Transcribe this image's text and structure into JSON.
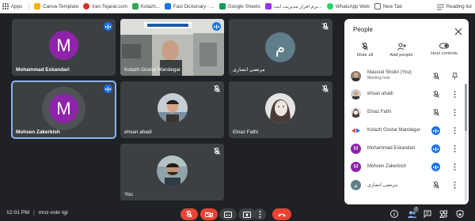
{
  "bookmarks": [
    {
      "label": "Apps",
      "icon": "apps-grid-icon",
      "color": "#5f6368"
    },
    {
      "label": "Canva-Template",
      "icon": "bookmark-icon",
      "color": "#f4b400"
    },
    {
      "label": "Iran-Tejarat.com",
      "icon": "site-icon",
      "color": "#d93025"
    },
    {
      "label": "Kolazh...",
      "icon": "site-icon",
      "color": "#34a853"
    },
    {
      "label": "Fast Dictionary - ...",
      "icon": "site-icon",
      "color": "#1a73e8"
    },
    {
      "label": "Google Sheets",
      "icon": "sheets-icon",
      "color": "#0f9d58"
    },
    {
      "label": "نرم افزار مدیریت ایت...",
      "icon": "site-icon",
      "color": "#9334e6"
    },
    {
      "label": "WhatsApp Web",
      "icon": "whatsapp-icon",
      "color": "#25d366"
    },
    {
      "label": "New Tab",
      "icon": "new-tab-icon",
      "color": "#5f6368"
    }
  ],
  "reading_list": "Reading list",
  "tiles": [
    {
      "name": "Mohammad Eskandari",
      "initial": "M",
      "type": "avatar",
      "mic": "active"
    },
    {
      "name": "Kolazh Gostar Mandegar",
      "type": "video",
      "mic": "active"
    },
    {
      "name": "مرتضی انصاری",
      "initial": "م",
      "type": "avatar",
      "mic": "muted"
    },
    {
      "name": "Mohsen Zakerkish",
      "initial": "M",
      "type": "avatar",
      "mic": "active"
    },
    {
      "name": "ehsan ahadi",
      "type": "photo",
      "mic": "muted"
    },
    {
      "name": "Elnaz Fathi",
      "type": "photo",
      "mic": "muted"
    },
    {
      "name": "You",
      "type": "photo",
      "mic": "muted"
    }
  ],
  "bottom_bar": {
    "time": "12:01 PM",
    "meeting_code": "mnz-vskr-tgi",
    "participant_count": "7"
  },
  "people_panel": {
    "title": "People",
    "actions": [
      {
        "label": "Mute all",
        "icon": "mute-all-icon"
      },
      {
        "label": "Add people",
        "icon": "add-person-icon"
      },
      {
        "label": "Host controls",
        "icon": "toggle-icon"
      }
    ],
    "participants": [
      {
        "name": "Masoud Shokri (You)",
        "subtitle": "Meeting host",
        "mic": "muted",
        "trailing": "pin"
      },
      {
        "name": "ehsan ahadi",
        "subtitle": "",
        "mic": "muted",
        "trailing": "more"
      },
      {
        "name": "Elnaz Fathi",
        "subtitle": "",
        "mic": "muted",
        "trailing": "more"
      },
      {
        "name": "Kolazh Gostar Mandegar",
        "subtitle": "",
        "mic": "on",
        "trailing": "more"
      },
      {
        "name": "Mohammad Eskandari",
        "subtitle": "",
        "mic": "on",
        "trailing": "more"
      },
      {
        "name": "Mohsen Zakerkish",
        "subtitle": "",
        "mic": "on",
        "trailing": "more"
      },
      {
        "name": "مرتضی انصاری",
        "subtitle": "",
        "mic": "muted",
        "trailing": "more"
      }
    ]
  },
  "colors": {
    "background": "#202124",
    "tile": "#3c4043",
    "avatar_purple": "#8e24aa",
    "avatar_slate": "#607d8b",
    "accent_blue": "#1a73e8",
    "danger_red": "#ea4335",
    "active_outline": "#8ab4f8"
  }
}
